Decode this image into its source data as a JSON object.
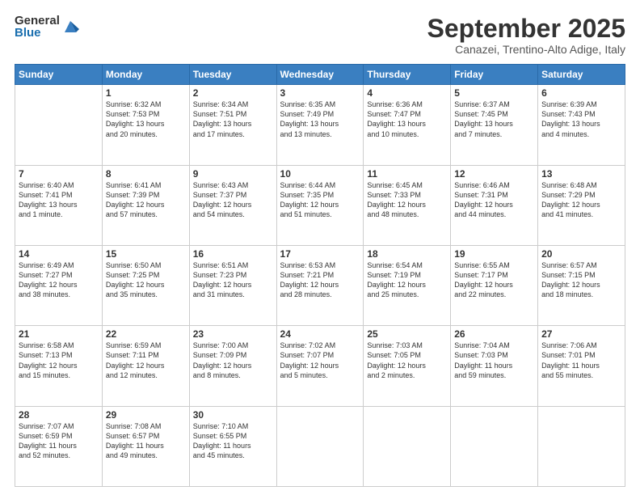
{
  "logo": {
    "general": "General",
    "blue": "Blue"
  },
  "header": {
    "month": "September 2025",
    "location": "Canazei, Trentino-Alto Adige, Italy"
  },
  "weekdays": [
    "Sunday",
    "Monday",
    "Tuesday",
    "Wednesday",
    "Thursday",
    "Friday",
    "Saturday"
  ],
  "weeks": [
    [
      {
        "day": "",
        "lines": []
      },
      {
        "day": "1",
        "lines": [
          "Sunrise: 6:32 AM",
          "Sunset: 7:53 PM",
          "Daylight: 13 hours",
          "and 20 minutes."
        ]
      },
      {
        "day": "2",
        "lines": [
          "Sunrise: 6:34 AM",
          "Sunset: 7:51 PM",
          "Daylight: 13 hours",
          "and 17 minutes."
        ]
      },
      {
        "day": "3",
        "lines": [
          "Sunrise: 6:35 AM",
          "Sunset: 7:49 PM",
          "Daylight: 13 hours",
          "and 13 minutes."
        ]
      },
      {
        "day": "4",
        "lines": [
          "Sunrise: 6:36 AM",
          "Sunset: 7:47 PM",
          "Daylight: 13 hours",
          "and 10 minutes."
        ]
      },
      {
        "day": "5",
        "lines": [
          "Sunrise: 6:37 AM",
          "Sunset: 7:45 PM",
          "Daylight: 13 hours",
          "and 7 minutes."
        ]
      },
      {
        "day": "6",
        "lines": [
          "Sunrise: 6:39 AM",
          "Sunset: 7:43 PM",
          "Daylight: 13 hours",
          "and 4 minutes."
        ]
      }
    ],
    [
      {
        "day": "7",
        "lines": [
          "Sunrise: 6:40 AM",
          "Sunset: 7:41 PM",
          "Daylight: 13 hours",
          "and 1 minute."
        ]
      },
      {
        "day": "8",
        "lines": [
          "Sunrise: 6:41 AM",
          "Sunset: 7:39 PM",
          "Daylight: 12 hours",
          "and 57 minutes."
        ]
      },
      {
        "day": "9",
        "lines": [
          "Sunrise: 6:43 AM",
          "Sunset: 7:37 PM",
          "Daylight: 12 hours",
          "and 54 minutes."
        ]
      },
      {
        "day": "10",
        "lines": [
          "Sunrise: 6:44 AM",
          "Sunset: 7:35 PM",
          "Daylight: 12 hours",
          "and 51 minutes."
        ]
      },
      {
        "day": "11",
        "lines": [
          "Sunrise: 6:45 AM",
          "Sunset: 7:33 PM",
          "Daylight: 12 hours",
          "and 48 minutes."
        ]
      },
      {
        "day": "12",
        "lines": [
          "Sunrise: 6:46 AM",
          "Sunset: 7:31 PM",
          "Daylight: 12 hours",
          "and 44 minutes."
        ]
      },
      {
        "day": "13",
        "lines": [
          "Sunrise: 6:48 AM",
          "Sunset: 7:29 PM",
          "Daylight: 12 hours",
          "and 41 minutes."
        ]
      }
    ],
    [
      {
        "day": "14",
        "lines": [
          "Sunrise: 6:49 AM",
          "Sunset: 7:27 PM",
          "Daylight: 12 hours",
          "and 38 minutes."
        ]
      },
      {
        "day": "15",
        "lines": [
          "Sunrise: 6:50 AM",
          "Sunset: 7:25 PM",
          "Daylight: 12 hours",
          "and 35 minutes."
        ]
      },
      {
        "day": "16",
        "lines": [
          "Sunrise: 6:51 AM",
          "Sunset: 7:23 PM",
          "Daylight: 12 hours",
          "and 31 minutes."
        ]
      },
      {
        "day": "17",
        "lines": [
          "Sunrise: 6:53 AM",
          "Sunset: 7:21 PM",
          "Daylight: 12 hours",
          "and 28 minutes."
        ]
      },
      {
        "day": "18",
        "lines": [
          "Sunrise: 6:54 AM",
          "Sunset: 7:19 PM",
          "Daylight: 12 hours",
          "and 25 minutes."
        ]
      },
      {
        "day": "19",
        "lines": [
          "Sunrise: 6:55 AM",
          "Sunset: 7:17 PM",
          "Daylight: 12 hours",
          "and 22 minutes."
        ]
      },
      {
        "day": "20",
        "lines": [
          "Sunrise: 6:57 AM",
          "Sunset: 7:15 PM",
          "Daylight: 12 hours",
          "and 18 minutes."
        ]
      }
    ],
    [
      {
        "day": "21",
        "lines": [
          "Sunrise: 6:58 AM",
          "Sunset: 7:13 PM",
          "Daylight: 12 hours",
          "and 15 minutes."
        ]
      },
      {
        "day": "22",
        "lines": [
          "Sunrise: 6:59 AM",
          "Sunset: 7:11 PM",
          "Daylight: 12 hours",
          "and 12 minutes."
        ]
      },
      {
        "day": "23",
        "lines": [
          "Sunrise: 7:00 AM",
          "Sunset: 7:09 PM",
          "Daylight: 12 hours",
          "and 8 minutes."
        ]
      },
      {
        "day": "24",
        "lines": [
          "Sunrise: 7:02 AM",
          "Sunset: 7:07 PM",
          "Daylight: 12 hours",
          "and 5 minutes."
        ]
      },
      {
        "day": "25",
        "lines": [
          "Sunrise: 7:03 AM",
          "Sunset: 7:05 PM",
          "Daylight: 12 hours",
          "and 2 minutes."
        ]
      },
      {
        "day": "26",
        "lines": [
          "Sunrise: 7:04 AM",
          "Sunset: 7:03 PM",
          "Daylight: 11 hours",
          "and 59 minutes."
        ]
      },
      {
        "day": "27",
        "lines": [
          "Sunrise: 7:06 AM",
          "Sunset: 7:01 PM",
          "Daylight: 11 hours",
          "and 55 minutes."
        ]
      }
    ],
    [
      {
        "day": "28",
        "lines": [
          "Sunrise: 7:07 AM",
          "Sunset: 6:59 PM",
          "Daylight: 11 hours",
          "and 52 minutes."
        ]
      },
      {
        "day": "29",
        "lines": [
          "Sunrise: 7:08 AM",
          "Sunset: 6:57 PM",
          "Daylight: 11 hours",
          "and 49 minutes."
        ]
      },
      {
        "day": "30",
        "lines": [
          "Sunrise: 7:10 AM",
          "Sunset: 6:55 PM",
          "Daylight: 11 hours",
          "and 45 minutes."
        ]
      },
      {
        "day": "",
        "lines": []
      },
      {
        "day": "",
        "lines": []
      },
      {
        "day": "",
        "lines": []
      },
      {
        "day": "",
        "lines": []
      }
    ]
  ]
}
